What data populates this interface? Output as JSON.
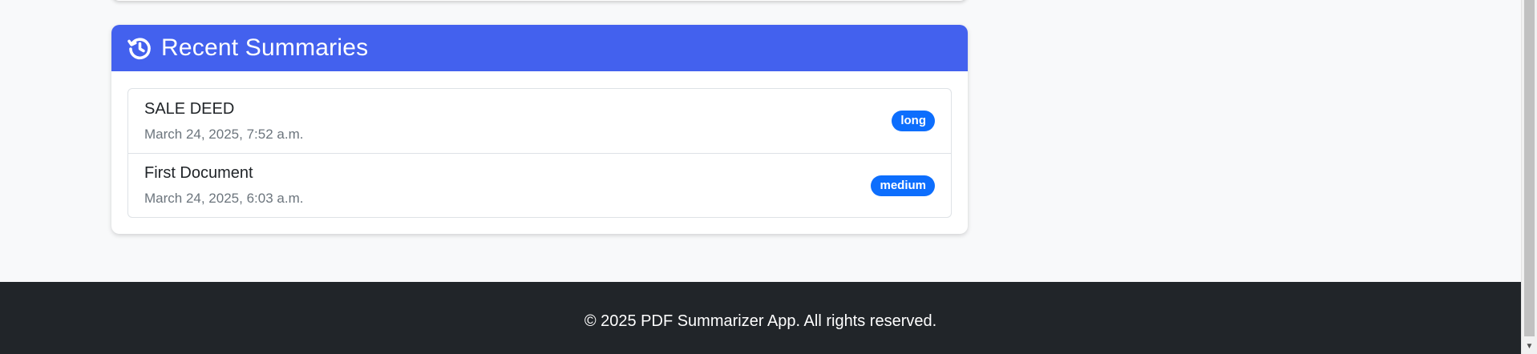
{
  "recent_summaries": {
    "title": "Recent Summaries",
    "icon": "history-icon",
    "header_color": "#4361ee",
    "items": [
      {
        "title": "SALE DEED",
        "date": "March 24, 2025, 7:52 a.m.",
        "badge": "long"
      },
      {
        "title": "First Document",
        "date": "March 24, 2025, 6:03 a.m.",
        "badge": "medium"
      }
    ]
  },
  "footer": {
    "text": "© 2025 PDF Summarizer App. All rights reserved."
  },
  "colors": {
    "badge": "#0d6efd",
    "footer_bg": "#212529",
    "page_bg": "#f8f9fa"
  }
}
